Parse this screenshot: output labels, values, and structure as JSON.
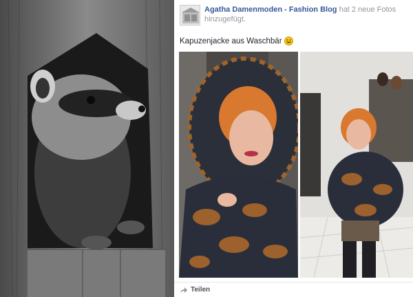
{
  "post": {
    "author": "Agatha Damenmoden - Fashion Blog",
    "action": " hat 2 neue Fotos hinzugefügt.",
    "caption": "Kapuzenjacke aus Waschbär",
    "share_label": "Teilen"
  },
  "icons": {
    "avatar": "store-avatar",
    "emoji": "smiling-face-emoji",
    "share": "share-arrow-icon"
  },
  "colors": {
    "author_link": "#365899",
    "meta_text": "#90949c"
  }
}
